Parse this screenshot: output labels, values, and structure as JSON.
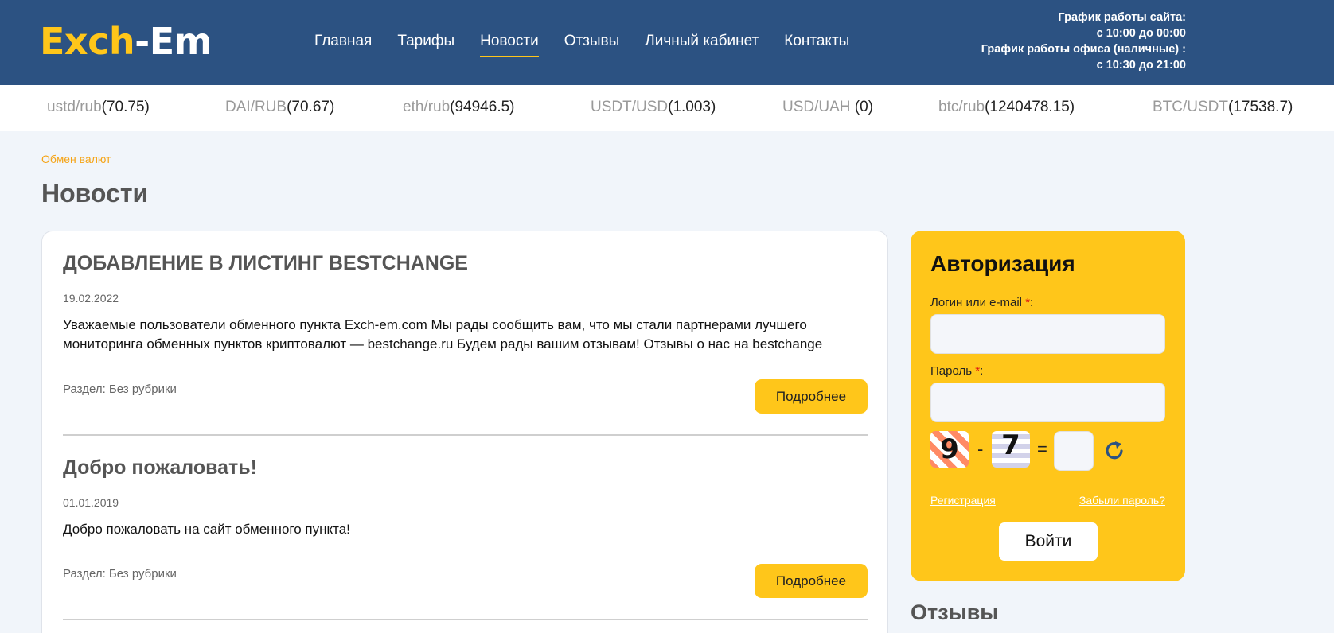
{
  "header": {
    "logo_part1": "Exch",
    "logo_part2": "-Em",
    "nav": [
      "Главная",
      "Тарифы",
      "Новости",
      "Отзывы",
      "Личный кабинет",
      "Контакты"
    ],
    "active_nav": "Новости",
    "schedule": [
      "График работы сайта:",
      "с 10:00 до 00:00",
      "График работы офиса (наличные) :",
      "с 10:30 до 21:00"
    ],
    "brand_colors": {
      "header_bg": "#2c5282",
      "accent": "#ffc61a"
    }
  },
  "ticker": [
    {
      "pair": "ustd/rub",
      "rate": "(70.75)"
    },
    {
      "pair": "DAI/RUB",
      "rate": "(70.67)"
    },
    {
      "pair": "eth/rub",
      "rate": "(94946.5)"
    },
    {
      "pair": "USDT/USD",
      "rate": "(1.003)"
    },
    {
      "pair": "USD/UAH ",
      "rate": "(0)"
    },
    {
      "pair": "btc/rub",
      "rate": "(1240478.15)"
    },
    {
      "pair": "BTC/USDT",
      "rate": "(17538.7)"
    }
  ],
  "breadcrumb": "Обмен валют",
  "page_title": "Новости",
  "news": [
    {
      "title": "ДОБАВЛЕНИЕ В ЛИСТИНГ BESTCHANGE",
      "date": "19.02.2022",
      "text": "Уважаемые пользователи обменного пункта Exch-em.com Мы рады сообщить вам, что мы стали партнерами лучшего мониторинга обменных пунктов криптовалют — bestchange.ru Будем рады вашим отзывам! Отзывы о нас на bestchange",
      "category": "Раздел: Без рубрики",
      "more": "Подробнее"
    },
    {
      "title": "Добро пожаловать!",
      "date": "01.01.2019",
      "text": "Добро пожаловать на сайт обменного пункта!",
      "category": "Раздел: Без рубрики",
      "more": "Подробнее"
    }
  ],
  "auth": {
    "title": "Авторизация",
    "login_label": "Логин или e-mail ",
    "password_label": "Пароль ",
    "required_mark": "*",
    "colon": ":",
    "captcha": {
      "a": "9",
      "op": "-",
      "b": "7",
      "eq": "="
    },
    "register": "Регистрация",
    "forgot": "Забыли пароль?",
    "submit": "Войти"
  },
  "reviews_title": "Отзывы"
}
